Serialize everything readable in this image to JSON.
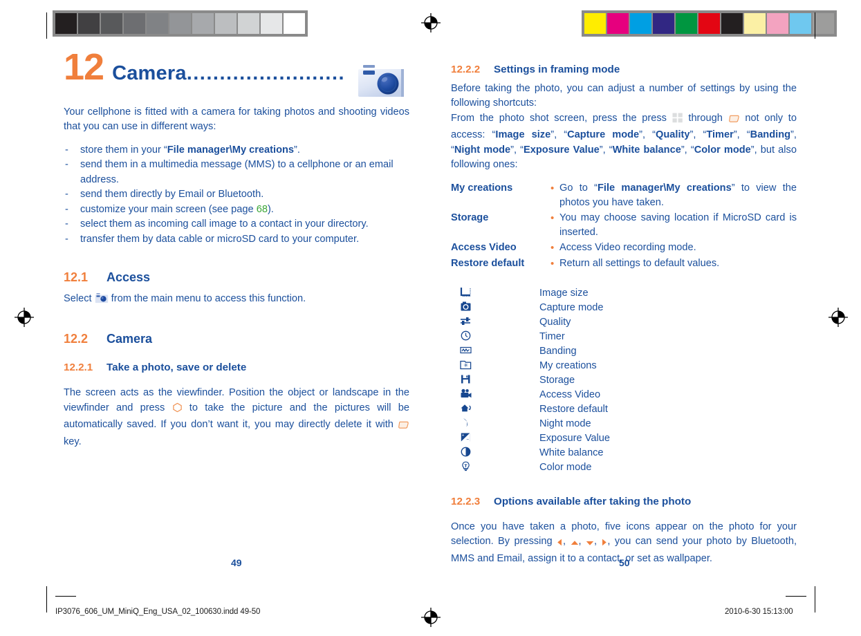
{
  "document": {
    "chapter_number": "12",
    "chapter_title": "Camera",
    "dot_leader": "........................",
    "page_left": "49",
    "page_right": "50",
    "footer_file": "IP3076_606_UM_MiniQ_Eng_USA_02_100630.indd   49-50",
    "footer_date": "2010-6-30   15:13:00"
  },
  "colors": {
    "heading_blue": "#1b4f9c",
    "accent_orange": "#f07f3c",
    "link_green": "#3aa636",
    "body_blue": "#1b4f9c"
  },
  "left_page": {
    "intro": "Your cellphone is fitted with a camera for taking photos and shooting videos that you can use in different ways:",
    "dash": "-",
    "bullets": [
      {
        "pre": "store them in your “",
        "bold": "File manager\\My creations",
        "post": "”."
      },
      {
        "pre": "send them in a multimedia message (MMS) to a cellphone or an email address.",
        "bold": "",
        "post": ""
      },
      {
        "pre": "send them directly by Email or Bluetooth.",
        "bold": "",
        "post": ""
      },
      {
        "pre": "customize your main screen (see page ",
        "green": "68",
        "post": ")."
      },
      {
        "pre": "select them as incoming call image to a contact in your directory.",
        "bold": "",
        "post": ""
      },
      {
        "pre": "transfer them by data cable or microSD card to your computer.",
        "bold": "",
        "post": ""
      }
    ],
    "section_access": {
      "number": "12.1",
      "title": "Access",
      "text_before_icon": "Select ",
      "text_after_icon": " from the main menu to access this function."
    },
    "section_camera": {
      "number": "12.2",
      "title": "Camera"
    },
    "subsection_take_photo": {
      "number": "12.2.1",
      "title": "Take a photo, save or delete",
      "part1": "The screen acts as the viewfinder. Position the object or landscape in the viewfinder and press ",
      "part2": " to take the picture and the pictures will be automatically saved. If you don’t want it, you may directly delete it with ",
      "part3": " key."
    }
  },
  "right_page": {
    "subsection_framing": {
      "number": "12.2.2",
      "title": "Settings in framing mode",
      "para1": "Before taking the photo, you can adjust a number of settings by using the following shortcuts:",
      "para2_a": "From the photo shot screen, press the press ",
      "para2_b": " through ",
      "para2_c": " not only to access: ",
      "shortcut_terms": [
        "Image size",
        "Capture mode",
        "Quality",
        "Timer",
        "Banding",
        "Night mode",
        "Exposure Value",
        "White balance",
        "Color mode"
      ],
      "para2_tail": "but also following ones:"
    },
    "settings_rows": [
      {
        "term": "My creations",
        "bullet": "•",
        "desc_pre": "Go to “",
        "desc_bold": "File manager\\My creations",
        "desc_post": "” to view the photos you have taken."
      },
      {
        "term": "Storage",
        "bullet": "•",
        "desc_pre": "You may choose saving location if MicroSD card is inserted.",
        "desc_bold": "",
        "desc_post": ""
      },
      {
        "term": "Access Video",
        "bullet": "•",
        "desc_pre": "Access Video recording mode.",
        "desc_bold": "",
        "desc_post": ""
      },
      {
        "term": "Restore default",
        "bullet": "•",
        "desc_pre": "Return all settings to default values.",
        "desc_bold": "",
        "desc_post": ""
      }
    ],
    "icon_legend": [
      {
        "icon": "image-size-icon",
        "label": "Image size"
      },
      {
        "icon": "capture-mode-icon",
        "label": "Capture mode"
      },
      {
        "icon": "quality-slider-icon",
        "label": "Quality"
      },
      {
        "icon": "timer-clock-icon",
        "label": "Timer"
      },
      {
        "icon": "banding-wave-icon",
        "label": "Banding"
      },
      {
        "icon": "my-creations-folder-icon",
        "label": "My creations"
      },
      {
        "icon": "storage-floppy-icon",
        "label": "Storage"
      },
      {
        "icon": "access-video-camcorder-icon",
        "label": "Access Video"
      },
      {
        "icon": "restore-default-home-icon",
        "label": "Restore default"
      },
      {
        "icon": "night-mode-moon-icon",
        "label": "Night mode"
      },
      {
        "icon": "exposure-value-icon",
        "label": "Exposure Value"
      },
      {
        "icon": "white-balance-contrast-icon",
        "label": "White balance"
      },
      {
        "icon": "color-mode-bulb-icon",
        "label": "Color mode"
      }
    ],
    "subsection_options": {
      "number": "12.2.3",
      "title": "Options available after taking the photo",
      "part1": "Once you have taken a photo, five icons appear on the photo for your selection. By pressing ",
      "part2": ", you can send your photo by Bluetooth, MMS and Email, assign it to a contact, or set as wallpaper."
    }
  },
  "print_marks": {
    "gray_wedge": [
      "#231f20",
      "#414042",
      "#58595b",
      "#6d6e71",
      "#808285",
      "#939598",
      "#a7a9ac",
      "#bcbec0",
      "#d1d3d4",
      "#e6e7e8",
      "#ffffff"
    ],
    "color_bar": [
      "#ffed00",
      "#e6007e",
      "#009fe3",
      "#312783",
      "#009640",
      "#e30613",
      "#231f20",
      "#fbf0a5",
      "#f3a3c0",
      "#6fc8ef",
      "#9d9d9c"
    ],
    "registration_mark": "registration-target"
  }
}
